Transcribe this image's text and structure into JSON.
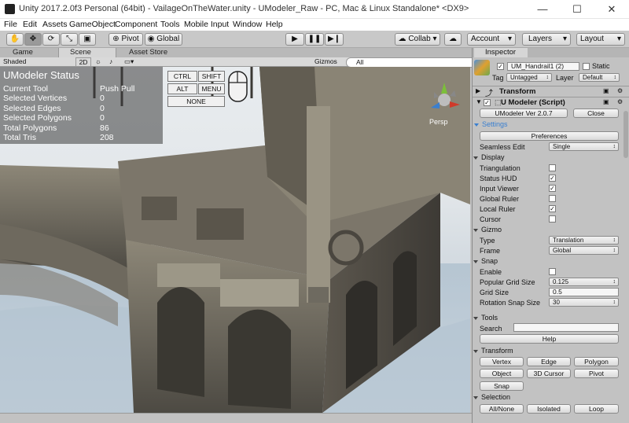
{
  "window": {
    "title": "Unity 2017.2.0f3 Personal (64bit) - VailageOnTheWater.unity - UModeler_Raw - PC, Mac & Linux Standalone* <DX9>",
    "minimize": "—",
    "maximize": "☐",
    "close": "✕"
  },
  "menu": [
    "File",
    "Edit",
    "Assets",
    "GameObject",
    "Component",
    "Tools",
    "Mobile Input",
    "Window",
    "Help"
  ],
  "toolbar": {
    "pivot": "Pivot",
    "global": "Global",
    "collab": "Collab ▾",
    "account": "Account",
    "layers": "Layers",
    "layout": "Layout"
  },
  "scene": {
    "tab_game": "Game",
    "tab_scene": "Scene",
    "tab_store": "Asset Store",
    "shading": "Shaded",
    "mode2d": "2D",
    "gizmos": "Gizmos",
    "search_placeholder": "All",
    "persp": "Persp"
  },
  "hud": {
    "title": "UModeler Status",
    "rows": [
      {
        "label": "Current Tool",
        "value": "Push Pull"
      },
      {
        "label": "Selected Vertices",
        "value": "0"
      },
      {
        "label": "Selected Edges",
        "value": "0"
      },
      {
        "label": "Selected Polygons",
        "value": "0"
      },
      {
        "label": "Total Polygons",
        "value": "86"
      },
      {
        "label": "Total Tris",
        "value": "208"
      }
    ],
    "keys": {
      "ctrl": "CTRL",
      "shift": "SHIFT",
      "alt": "ALT",
      "menu": "MENU",
      "none": "NONE"
    }
  },
  "inspector": {
    "tab": "Inspector",
    "object_name": "UM_Handrail1 (2)",
    "static": "Static",
    "tag_label": "Tag",
    "tag_value": "Untagged",
    "layer_label": "Layer",
    "layer_value": "Default",
    "transform": "Transform",
    "script": "U Modeler (Script)",
    "version": "UModeler Ver 2.0.7",
    "close": "Close",
    "settings": "Settings",
    "preferences": "Preferences",
    "seamless_label": "Seamless Edit",
    "seamless_value": "Single",
    "display": "Display",
    "display_items": [
      {
        "label": "Triangulation",
        "checked": false
      },
      {
        "label": "Status HUD",
        "checked": true
      },
      {
        "label": "Input Viewer",
        "checked": true
      },
      {
        "label": "Global Ruler",
        "checked": false
      },
      {
        "label": "Local Ruler",
        "checked": true
      },
      {
        "label": "Cursor",
        "checked": false
      }
    ],
    "gizmo": "Gizmo",
    "gizmo_type_label": "Type",
    "gizmo_type_value": "Translation",
    "gizmo_frame_label": "Frame",
    "gizmo_frame_value": "Global",
    "snap": "Snap",
    "snap_enable": "Enable",
    "popular_grid_label": "Popular Grid Size",
    "popular_grid_value": "0.125",
    "grid_size_label": "Grid Size",
    "grid_size_value": "0.5",
    "rotation_snap_label": "Rotation Snap Size",
    "rotation_snap_value": "30",
    "tools": "Tools",
    "search_label": "Search",
    "help": "Help",
    "transform_section": "Transform",
    "transform_buttons": [
      "Vertex",
      "Edge",
      "Polygon",
      "Object",
      "3D Cursor",
      "Pivot",
      "Snap"
    ],
    "selection": "Selection",
    "selection_buttons": [
      "All/None",
      "Isolated",
      "Loop"
    ]
  },
  "colors": {
    "accent": "#3a7fd0",
    "hud_bg": "#3c3c3c",
    "panel": "#c2c2c2"
  }
}
